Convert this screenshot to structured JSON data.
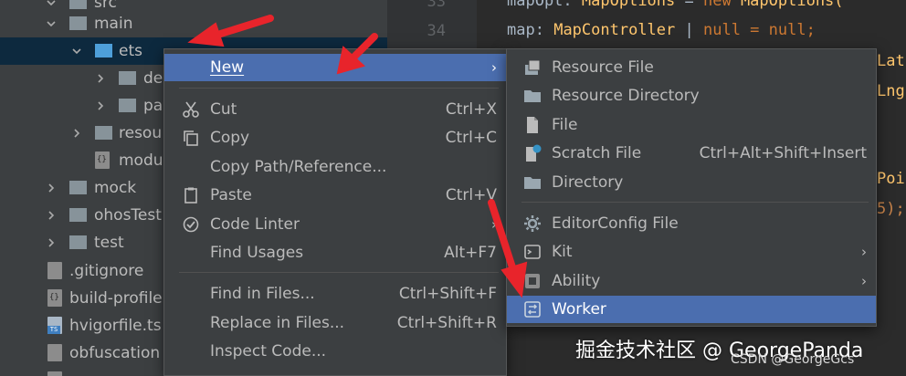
{
  "tree": {
    "items": [
      {
        "label": "src"
      },
      {
        "label": "main"
      },
      {
        "label": "ets"
      },
      {
        "label": "de"
      },
      {
        "label": "pa"
      },
      {
        "label": "resou"
      },
      {
        "label": "modu"
      },
      {
        "label": "mock"
      },
      {
        "label": "ohosTest"
      },
      {
        "label": "test"
      },
      {
        "label": ".gitignore"
      },
      {
        "label": "build-profile"
      },
      {
        "label": "hvigorfile.ts"
      },
      {
        "label": "obfuscation"
      }
    ],
    "ts_badge": "TS"
  },
  "editor": {
    "line_numbers": [
      "33",
      "34"
    ],
    "lines": [
      {
        "a": "mapOpt",
        "b": ": ",
        "c": "MapOptions",
        "d": " = ",
        "e": "new",
        "f": " MapOptions("
      },
      {
        "a": "map",
        "b": ": ",
        "c": "MapController",
        "d": " | ",
        "e": "null",
        "f": " = null;"
      }
    ],
    "fragments": [
      "Lat",
      "Lng",
      "Poi",
      "5);"
    ]
  },
  "menu_main": {
    "items": [
      {
        "label": "New",
        "shortcut": "",
        "submenu": true
      },
      {
        "label": "Cut",
        "shortcut": "Ctrl+X"
      },
      {
        "label": "Copy",
        "shortcut": "Ctrl+C"
      },
      {
        "label": "Copy Path/Reference...",
        "shortcut": ""
      },
      {
        "label": "Paste",
        "shortcut": "Ctrl+V"
      },
      {
        "label": "Code Linter",
        "shortcut": "",
        "submenu": true
      },
      {
        "label": "Find Usages",
        "shortcut": "Alt+F7"
      },
      {
        "label": "Find in Files...",
        "shortcut": "Ctrl+Shift+F"
      },
      {
        "label": "Replace in Files...",
        "shortcut": "Ctrl+Shift+R"
      },
      {
        "label": "Inspect Code...",
        "shortcut": ""
      }
    ],
    "arrow": "›"
  },
  "menu_new": {
    "items": [
      {
        "label": "Resource File",
        "shortcut": ""
      },
      {
        "label": "Resource Directory",
        "shortcut": ""
      },
      {
        "label": "File",
        "shortcut": ""
      },
      {
        "label": "Scratch File",
        "shortcut": "Ctrl+Alt+Shift+Insert"
      },
      {
        "label": "Directory",
        "shortcut": ""
      },
      {
        "label": "EditorConfig File",
        "shortcut": ""
      },
      {
        "label": "Kit",
        "shortcut": "",
        "submenu": true
      },
      {
        "label": "Ability",
        "shortcut": "",
        "submenu": true
      },
      {
        "label": "Worker",
        "shortcut": ""
      }
    ],
    "arrow": "›"
  },
  "watermark": {
    "text": "掘金技术社区 @ GeorgePanda",
    "text2": "CSDN @GeorgeGcs"
  },
  "colors": {
    "highlight": "#4b6eaf",
    "tree_selected": "#0d293e",
    "annotation_arrow": "#e8242b",
    "folder_blue": "#4e9fd9"
  }
}
